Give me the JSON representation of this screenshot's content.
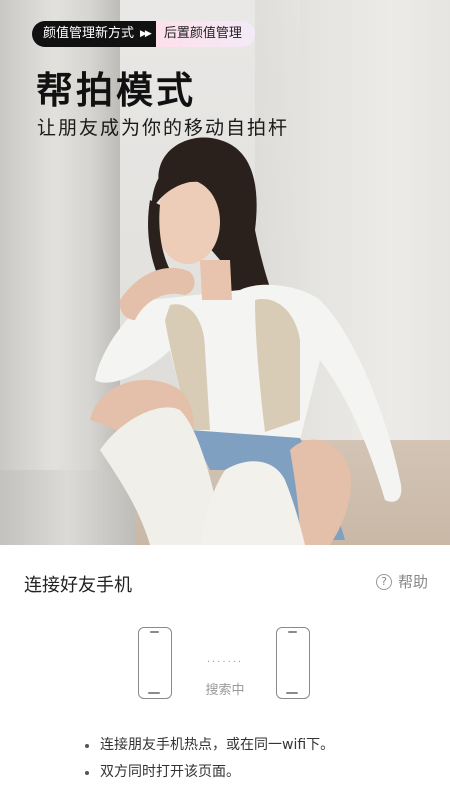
{
  "hero": {
    "tag_new": "颜值管理新方式",
    "tag_arrows": "▶▶",
    "tag_post": "后置颜值管理",
    "title": "帮拍模式",
    "subtitle": "让朋友成为你的移动自拍杆"
  },
  "panel": {
    "title": "连接好友手机",
    "help_icon": "?",
    "help_label": "帮助",
    "dots": "·······",
    "status": "搜索中",
    "tips": [
      "连接朋友手机热点，或在同一wifi下。",
      "双方同时打开该页面。"
    ]
  }
}
